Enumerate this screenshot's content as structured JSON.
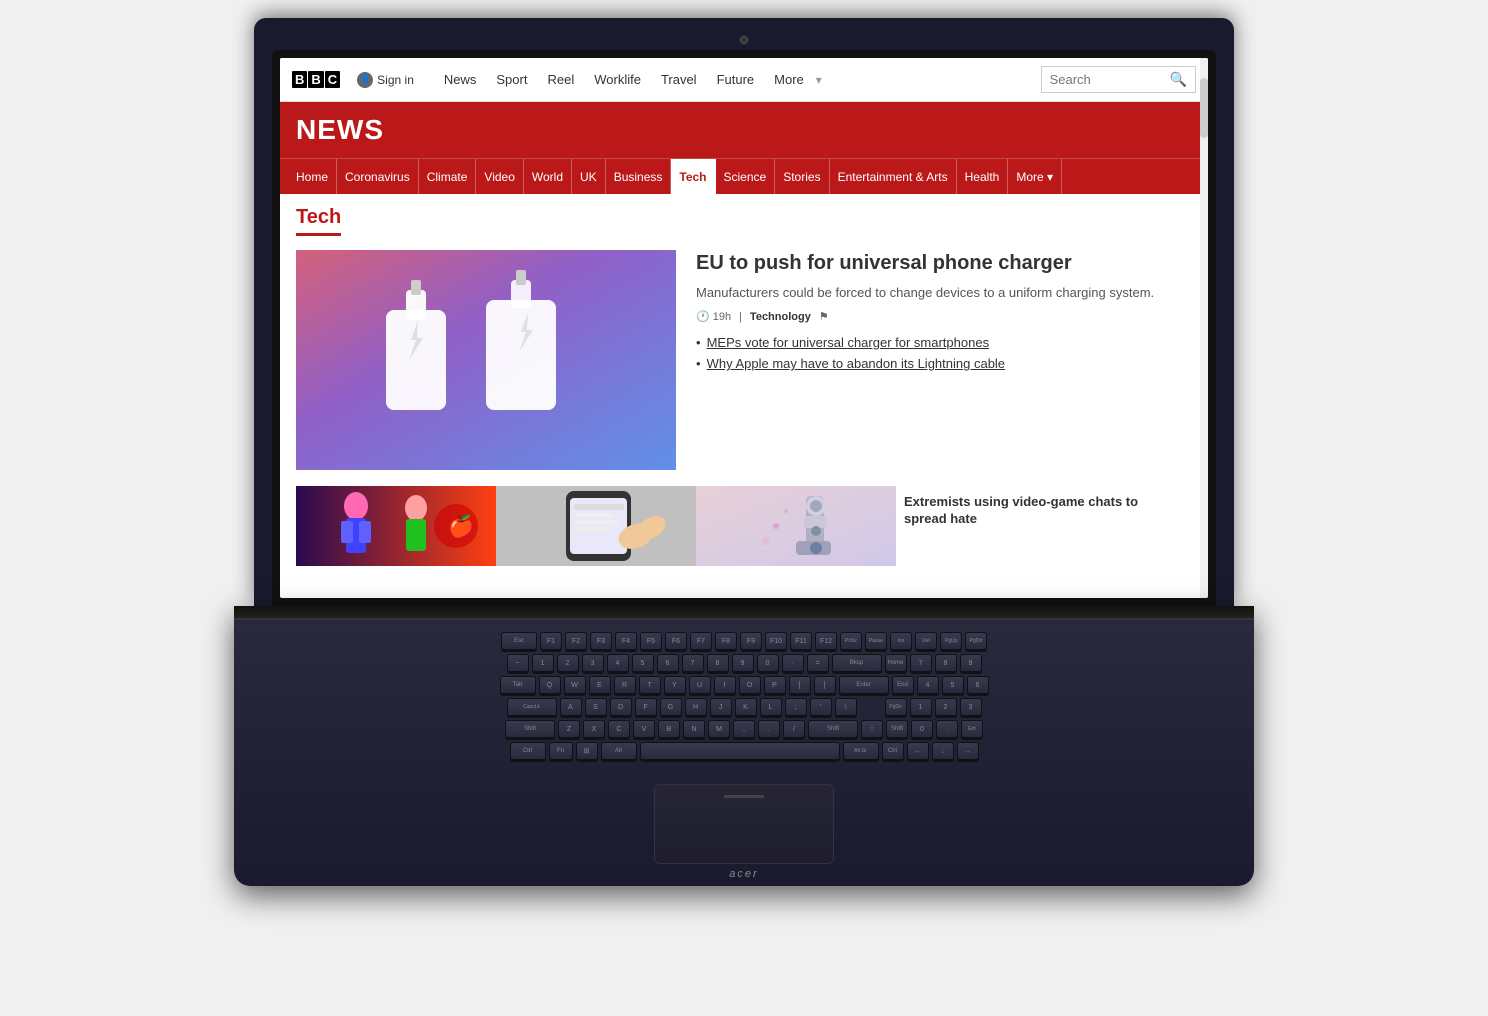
{
  "laptop": {
    "brand": "acer"
  },
  "bbc": {
    "logo": "BBC",
    "sign_in": "Sign in",
    "top_nav": {
      "links": [
        {
          "label": "News",
          "active": false
        },
        {
          "label": "Sport",
          "active": false
        },
        {
          "label": "Reel",
          "active": false
        },
        {
          "label": "Worklife",
          "active": false
        },
        {
          "label": "Travel",
          "active": false
        },
        {
          "label": "Future",
          "active": false
        },
        {
          "label": "More",
          "active": false
        }
      ],
      "search_placeholder": "Search"
    },
    "news_banner": "NEWS",
    "secondary_nav": [
      {
        "label": "Home",
        "active": false
      },
      {
        "label": "Coronavirus",
        "active": false
      },
      {
        "label": "Climate",
        "active": false
      },
      {
        "label": "Video",
        "active": false
      },
      {
        "label": "World",
        "active": false
      },
      {
        "label": "UK",
        "active": false
      },
      {
        "label": "Business",
        "active": false
      },
      {
        "label": "Tech",
        "active": true
      },
      {
        "label": "Science",
        "active": false
      },
      {
        "label": "Stories",
        "active": false
      },
      {
        "label": "Entertainment & Arts",
        "active": false
      },
      {
        "label": "Health",
        "active": false
      },
      {
        "label": "More ▾",
        "active": false
      }
    ],
    "section": "Tech",
    "main_story": {
      "title": "EU to push for universal phone charger",
      "description": "Manufacturers could be forced to change devices to a uniform charging system.",
      "time": "19h",
      "tag": "Technology",
      "bullets": [
        "MEPs vote for universal charger for smartphones",
        "Why Apple may have to abandon its Lightning cable"
      ]
    },
    "side_story": {
      "title": "Extremists using video-game chats to spread hate"
    }
  }
}
